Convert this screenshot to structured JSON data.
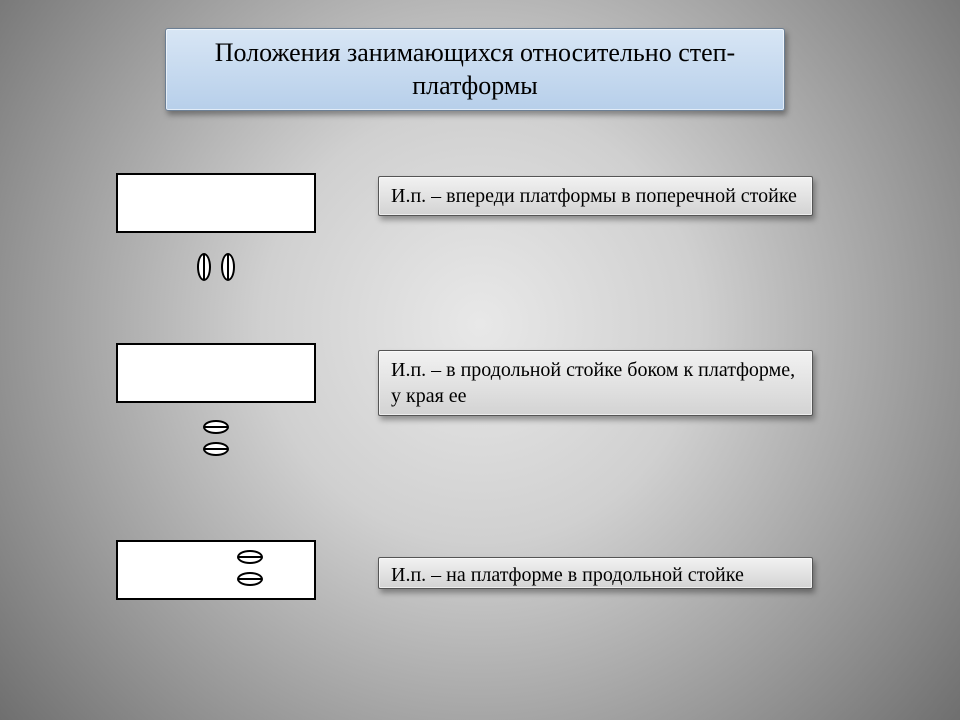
{
  "title": "Положения занимающихся относительно степ-платформы",
  "items": [
    {
      "desc": "И.п. – впереди платформы в поперечной стойке"
    },
    {
      "desc": "И.п. – в продольной стойке боком к платформе, у края ее"
    },
    {
      "desc": "И.п. – на платформе в продольной стойке"
    }
  ]
}
